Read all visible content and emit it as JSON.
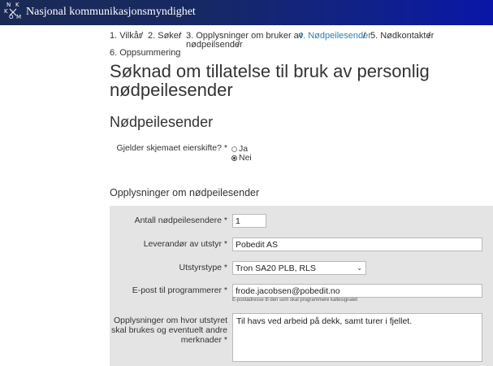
{
  "header": {
    "logo_letters": [
      "N",
      "K",
      "K",
      "O",
      "M"
    ],
    "site_title": "Nasjonal kommunikasjonsmyndighet"
  },
  "breadcrumb": {
    "steps": [
      {
        "label": "1. Vilkår"
      },
      {
        "label": "2. Søker"
      },
      {
        "label": "3. Opplysninger om bruker av"
      },
      {
        "label": "nødpeilsender"
      },
      {
        "label": "4. Nødpeilesender",
        "active": true
      },
      {
        "label": "5. Nødkontakter"
      },
      {
        "label": "6. Oppsummering"
      }
    ],
    "separator": "/"
  },
  "page_title": "Søknad om tillatelse til bruk av personlig nødpeilesender",
  "section_title": "Nødpeilesender",
  "ownership": {
    "label": "Gjelder skjemaet eierskifte? *",
    "options": [
      {
        "label": "Ja",
        "checked": false
      },
      {
        "label": "Nei",
        "checked": true
      }
    ]
  },
  "subsection_title": "Opplysninger om nødpeilesender",
  "form": {
    "count_label": "Antall nødpeilesendere *",
    "count_value": "1",
    "supplier_label": "Leverandør av utstyr *",
    "supplier_value": "Pobedit AS",
    "type_label": "Utstyrstype *",
    "type_value": "Tron SA20 PLB, RLS",
    "email_label": "E-post til programmerer *",
    "email_value": "frode.jacobsen@pobedit.no",
    "email_hint": "E-postadresse til den som skal programmere kallesignalet",
    "usage_label": "Opplysninger om hvor utstyret skal brukes og eventuelt andre merknader *",
    "usage_value": "Til havs ved arbeid på dekk, samt turer i fjellet."
  }
}
